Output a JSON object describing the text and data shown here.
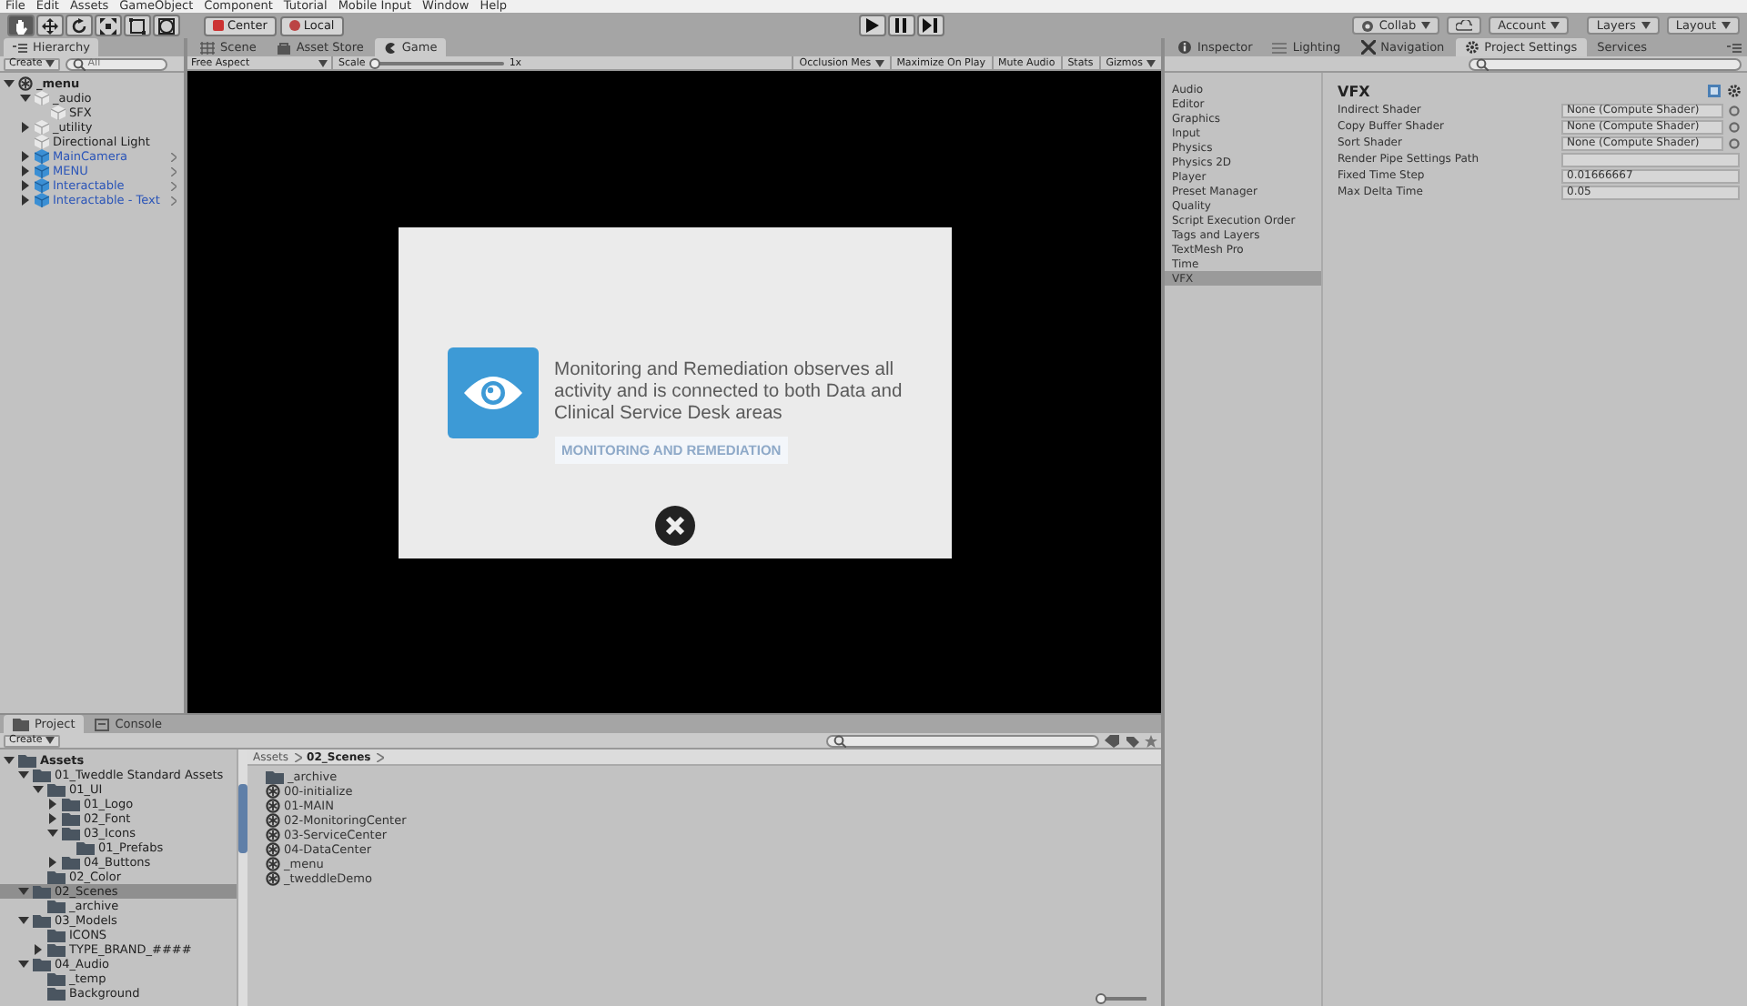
{
  "menu_bar": [
    "File",
    "Edit",
    "Assets",
    "GameObject",
    "Component",
    "Tutorial",
    "Mobile Input",
    "Window",
    "Help"
  ],
  "toolbar": {
    "tools": [
      {
        "kind": "hand",
        "selected": true
      },
      {
        "kind": "move",
        "selected": false
      },
      {
        "kind": "rotate",
        "selected": false
      },
      {
        "kind": "scale",
        "selected": false
      },
      {
        "kind": "rect",
        "selected": false
      },
      {
        "kind": "transform",
        "selected": false
      }
    ],
    "pivot_buttons": [
      {
        "kind": "center",
        "label": "Center"
      },
      {
        "kind": "local",
        "label": "Local"
      }
    ],
    "play_controls": [
      {
        "kind": "play"
      },
      {
        "kind": "pause"
      },
      {
        "kind": "step"
      }
    ],
    "right_buttons": [
      {
        "kind": "collab",
        "label": "Collab"
      },
      {
        "kind": "cloud"
      },
      {
        "kind": "dropdown",
        "label": "Account"
      },
      {
        "kind": "dropdown",
        "label": "Layers"
      },
      {
        "kind": "dropdown",
        "label": "Layout"
      }
    ]
  },
  "hierarchy": {
    "tab": "Hierarchy",
    "create": "Create",
    "search": {
      "placeholder": "All"
    },
    "tree": [
      {
        "label": "_menu",
        "kind": "scene",
        "expanded": true,
        "children": [
          {
            "label": "_audio",
            "kind": "object",
            "expanded": true,
            "children": [
              {
                "label": "SFX",
                "kind": "object"
              }
            ]
          },
          {
            "label": "_utility",
            "kind": "object",
            "expanded": false
          },
          {
            "label": "Directional Light",
            "kind": "object"
          },
          {
            "label": "MainCamera",
            "kind": "prefab",
            "expanded": false
          },
          {
            "label": "MENU",
            "kind": "prefab",
            "expanded": false
          },
          {
            "label": "Interactable",
            "kind": "prefab",
            "expanded": false
          },
          {
            "label": "Interactable - Text",
            "kind": "prefab",
            "expanded": false
          }
        ]
      }
    ]
  },
  "game": {
    "tabs": [
      {
        "kind": "scene",
        "label": "Scene",
        "selected": false
      },
      {
        "kind": "store",
        "label": "Asset Store",
        "selected": false
      },
      {
        "kind": "game",
        "label": "Game",
        "selected": true
      }
    ],
    "aspect": "Free Aspect",
    "scale_label": "Scale",
    "scale": {
      "level": 0
    },
    "scale_value": "1x",
    "buttons": [
      {
        "label": "Occlusion Mes",
        "dropdown": true
      },
      {
        "label": "Maximize On Play",
        "dropdown": false
      },
      {
        "label": "Mute Audio",
        "dropdown": false
      },
      {
        "label": "Stats",
        "dropdown": false
      },
      {
        "label": "Gizmos",
        "dropdown": true
      }
    ],
    "dialog": {
      "message": "Monitoring and Remediation observes all activity and is connected to both Data and Clinical Service Desk areas",
      "caption": "MONITORING AND REMEDIATION"
    }
  },
  "inspector": {
    "tabs": [
      {
        "kind": "inspector",
        "label": "Inspector",
        "selected": false
      },
      {
        "kind": "lighting",
        "label": "Lighting",
        "selected": false
      },
      {
        "kind": "navigation",
        "label": "Navigation",
        "selected": false
      },
      {
        "kind": "settings",
        "label": "Project Settings",
        "selected": true
      },
      {
        "kind": "plain",
        "label": "Services",
        "selected": false
      }
    ],
    "categories": [
      {
        "label": "Audio",
        "selected": false
      },
      {
        "label": "Editor",
        "selected": false
      },
      {
        "label": "Graphics",
        "selected": false
      },
      {
        "label": "Input",
        "selected": false
      },
      {
        "label": "Physics",
        "selected": false
      },
      {
        "label": "Physics 2D",
        "selected": false
      },
      {
        "label": "Player",
        "selected": false
      },
      {
        "label": "Preset Manager",
        "selected": false
      },
      {
        "label": "Quality",
        "selected": false
      },
      {
        "label": "Script Execution Order",
        "selected": false
      },
      {
        "label": "Tags and Layers",
        "selected": false
      },
      {
        "label": "TextMesh Pro",
        "selected": false
      },
      {
        "label": "Time",
        "selected": false
      },
      {
        "label": "VFX",
        "selected": true
      }
    ],
    "title": "VFX",
    "fields": [
      {
        "label": "Indirect Shader",
        "value": "None (Compute Shader)",
        "kind": "object"
      },
      {
        "label": "Copy Buffer Shader",
        "value": "None (Compute Shader)",
        "kind": "object"
      },
      {
        "label": "Sort Shader",
        "value": "None (Compute Shader)",
        "kind": "object"
      },
      {
        "label": "Render Pipe Settings Path",
        "kind": "text"
      },
      {
        "label": "Fixed Time Step",
        "value": "0.01666667",
        "kind": "text"
      },
      {
        "label": "Max Delta Time",
        "value": "0.05",
        "kind": "text"
      }
    ]
  },
  "project": {
    "tabs": [
      {
        "kind": "project",
        "label": "Project",
        "selected": true
      },
      {
        "kind": "console",
        "label": "Console",
        "selected": false
      }
    ],
    "create": "Create",
    "tree": [
      {
        "label": "Assets",
        "bold": true,
        "expanded": true,
        "selected": false,
        "children": [
          {
            "label": "01_Tweddle Standard Assets",
            "expanded": true,
            "selected": false,
            "children": [
              {
                "label": "01_UI",
                "expanded": true,
                "selected": false,
                "children": [
                  {
                    "label": "01_Logo",
                    "expanded": false,
                    "selected": false
                  },
                  {
                    "label": "02_Font",
                    "expanded": false,
                    "selected": false
                  },
                  {
                    "label": "03_Icons",
                    "expanded": true,
                    "selected": false,
                    "children": [
                      {
                        "label": "01_Prefabs",
                        "selected": false
                      }
                    ]
                  },
                  {
                    "label": "04_Buttons",
                    "expanded": false,
                    "selected": false
                  }
                ]
              },
              {
                "label": "02_Color",
                "selected": false
              }
            ]
          },
          {
            "label": "02_Scenes",
            "expanded": true,
            "selected": true,
            "children": [
              {
                "label": "_archive",
                "selected": false
              }
            ]
          },
          {
            "label": "03_Models",
            "expanded": true,
            "selected": false,
            "children": [
              {
                "label": "ICONS",
                "selected": false
              },
              {
                "label": "TYPE_BRAND_####",
                "expanded": false,
                "selected": false
              }
            ]
          },
          {
            "label": "04_Audio",
            "expanded": true,
            "selected": false,
            "children": [
              {
                "label": "_temp",
                "selected": false
              },
              {
                "label": "Background",
                "selected": false
              }
            ]
          }
        ]
      }
    ],
    "breadcrumb": [
      "Assets",
      "02_Scenes"
    ],
    "items": [
      {
        "kind": "folder",
        "label": "_archive"
      },
      {
        "kind": "scene",
        "label": "00-initialize"
      },
      {
        "kind": "scene",
        "label": "01-MAIN"
      },
      {
        "kind": "scene",
        "label": "02-MonitoringCenter"
      },
      {
        "kind": "scene",
        "label": "03-ServiceCenter"
      },
      {
        "kind": "scene",
        "label": "04-DataCenter"
      },
      {
        "kind": "scene",
        "label": "_menu"
      },
      {
        "kind": "scene",
        "label": "_tweddleDemo"
      }
    ],
    "icon_size": {
      "level": 0
    }
  }
}
